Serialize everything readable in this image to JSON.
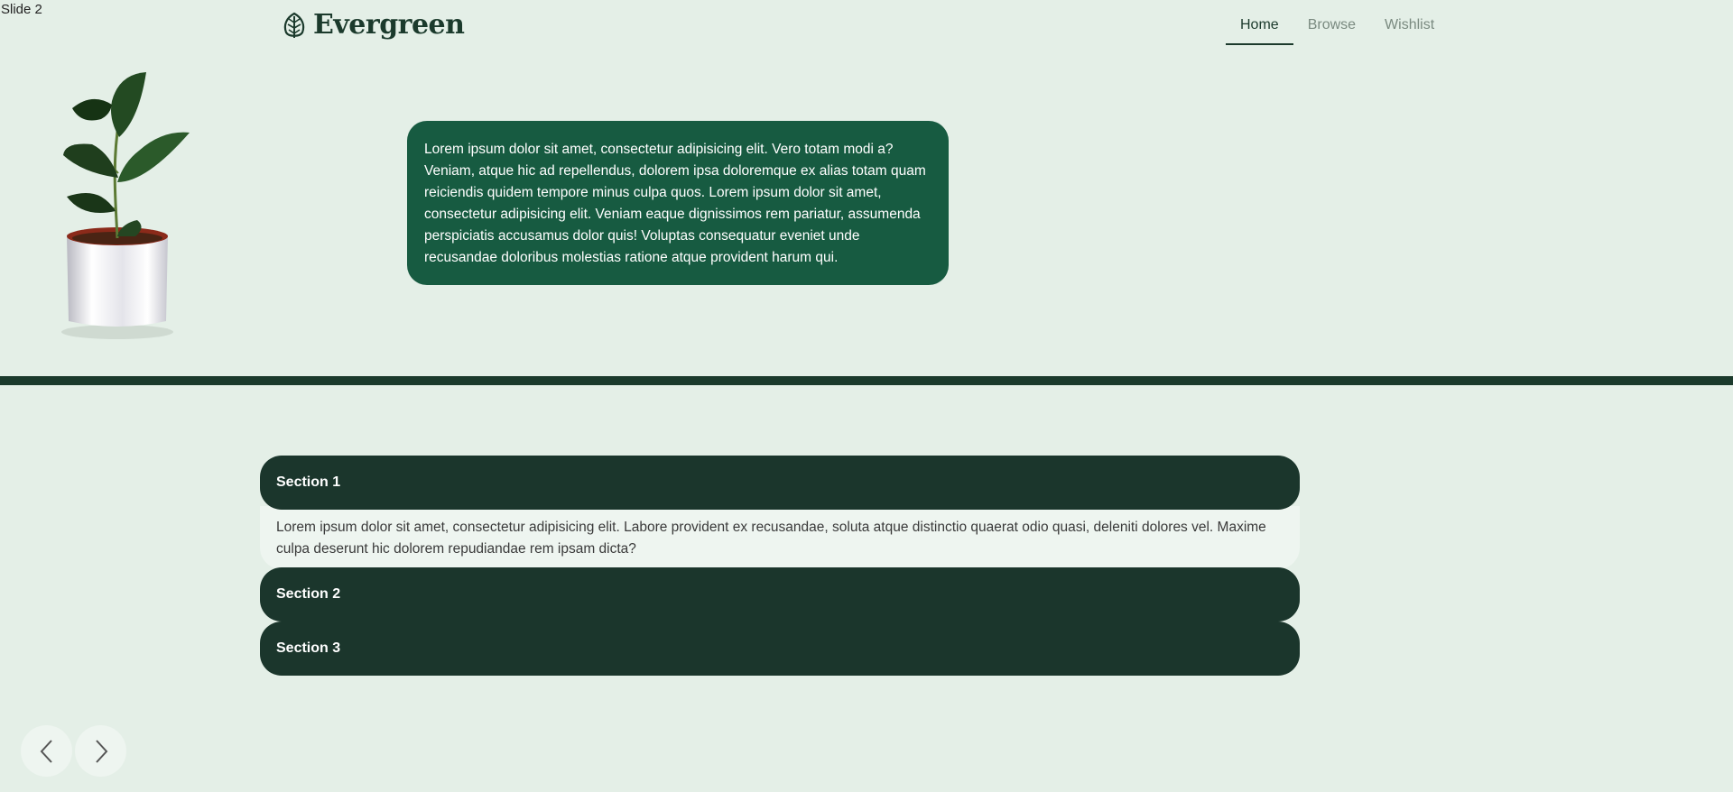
{
  "slide_label": "Slide 2",
  "brand": {
    "name": "Evergreen"
  },
  "nav": {
    "items": [
      {
        "label": "Home",
        "active": true
      },
      {
        "label": "Browse",
        "active": false
      },
      {
        "label": "Wishlist",
        "active": false
      }
    ]
  },
  "hero": {
    "text": "Lorem ipsum dolor sit amet, consectetur adipisicing elit. Vero totam modi a? Veniam, atque hic ad repellendus, dolorem ipsa doloremque ex alias totam quam reiciendis quidem tempore minus culpa quos. Lorem ipsum dolor sit amet, consectetur adipisicing elit. Veniam eaque dignissimos rem pariatur, assumenda perspiciatis accusamus dolor quis! Voluptas consequatur eveniet unde recusandae doloribus molestias ratione atque provident harum qui."
  },
  "accordion": {
    "sections": [
      {
        "title": "Section 1",
        "expanded": true,
        "body": "Lorem ipsum dolor sit amet, consectetur adipisicing elit. Labore provident ex recusandae, soluta atque distinctio quaerat odio quasi, deleniti dolores vel. Maxime culpa deserunt hic dolorem repudiandae rem ipsam dicta?"
      },
      {
        "title": "Section 2",
        "expanded": false
      },
      {
        "title": "Section 3",
        "expanded": false
      }
    ]
  },
  "colors": {
    "background": "#e4efe7",
    "brand_dark": "#1b3a2c",
    "card_green": "#175b41",
    "accordion_header": "#1b362c",
    "accordion_body": "#eef5f0"
  },
  "icons": {
    "logo": "leaf-icon",
    "prev": "chevron-left-icon",
    "next": "chevron-right-icon"
  }
}
